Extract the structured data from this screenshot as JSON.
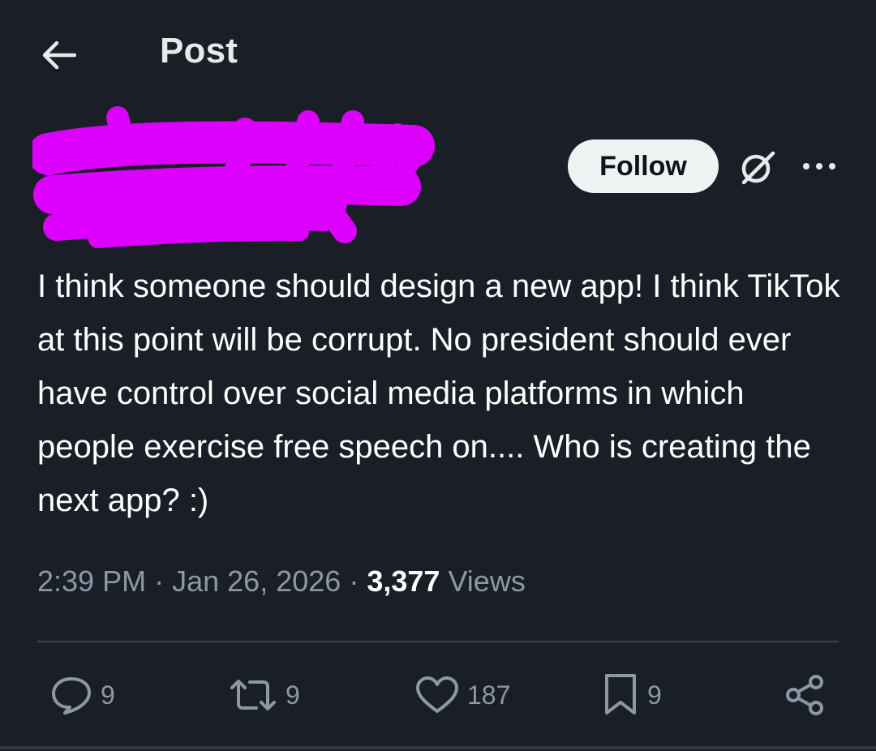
{
  "header": {
    "title": "Post",
    "back_icon": "arrow-left-icon"
  },
  "author": {
    "redacted": true,
    "redaction_color": "#dd00ff"
  },
  "follow_label": "Follow",
  "post": {
    "text": "I think someone should design a new app! I think TikTok at this point will be corrupt. No president should ever have control over social media platforms in which people exercise free speech on.... Who is creating the next app? :)",
    "time": "2:39 PM",
    "date": "Jan 26, 2026",
    "separator": "·",
    "views_count": "3,377",
    "views_label": "Views"
  },
  "actions": {
    "replies": "9",
    "reposts": "9",
    "likes": "187",
    "bookmarks": "9"
  },
  "colors": {
    "background": "#1a1f27",
    "text": "#ffffff",
    "muted": "#8b98a5",
    "follow_bg": "#eff3f4"
  }
}
